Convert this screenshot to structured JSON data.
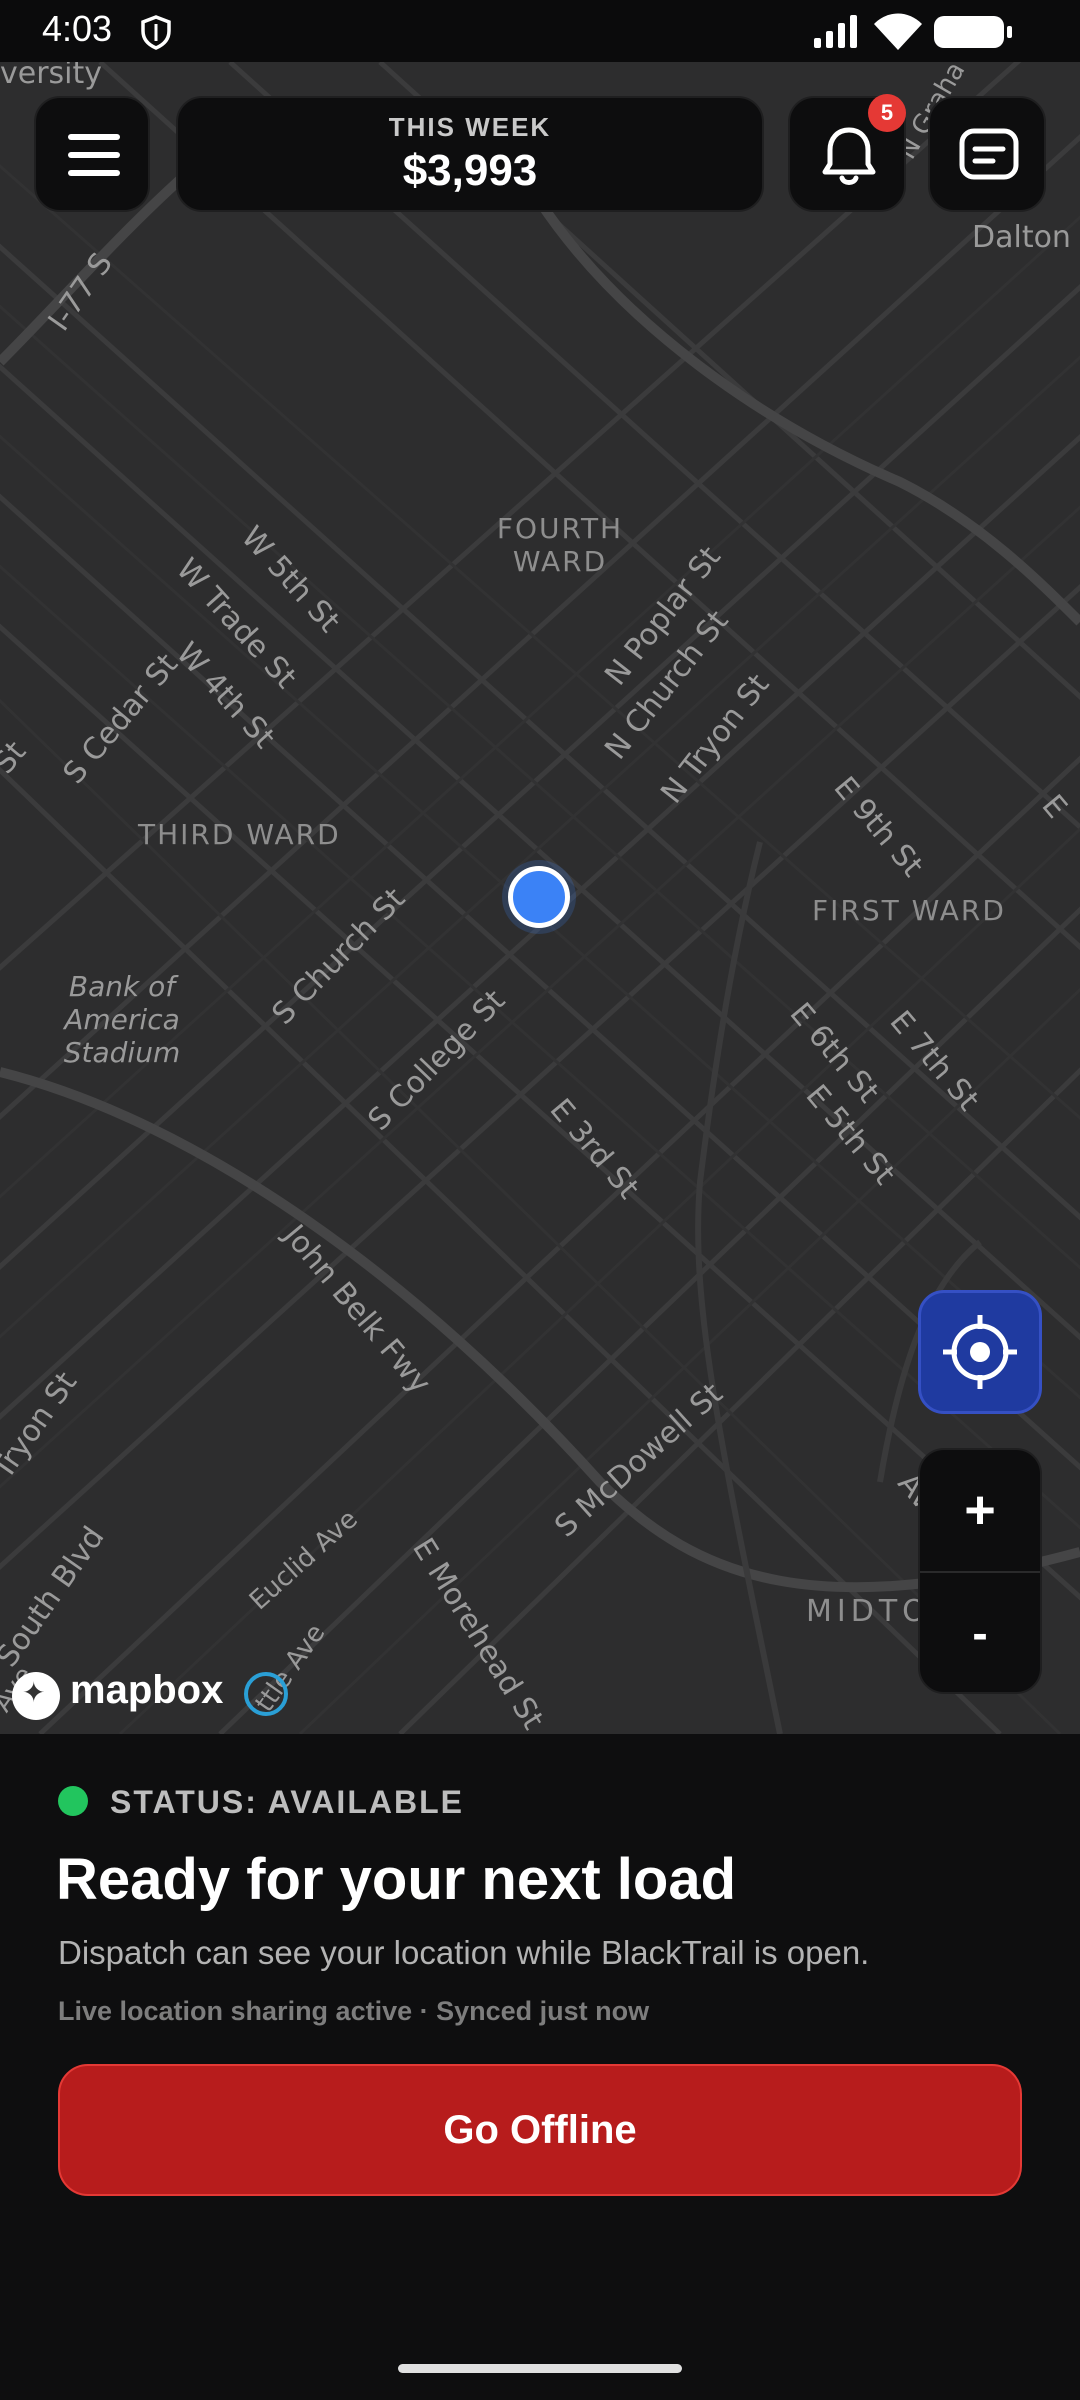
{
  "status_bar": {
    "time": "4:03"
  },
  "header": {
    "week_label": "THIS WEEK",
    "week_amount": "$3,993",
    "notification_count": "5"
  },
  "map": {
    "streets": [
      "W 5th St",
      "W Trade St",
      "W 4th St",
      "S Cedar St",
      "N Poplar St",
      "N Church St",
      "N Tryon St",
      "E 9th St",
      "S Church St",
      "S College St",
      "E 3rd St",
      "E 6th St",
      "E 7th St",
      "E 5th St",
      "John Belk Fwy",
      "S McDowell St",
      "E Morehead St",
      "Euclid Ave",
      "South Blvd",
      "I-77 S",
      "Tryon St",
      "Dalton A",
      "ttle Ave",
      "Ave",
      "St",
      "E",
      "versity",
      "N Graha"
    ],
    "districts": [
      "FOURTH WARD",
      "THIRD WARD",
      "FIRST WARD",
      "MIDTOWN"
    ],
    "stadium": "Bank of America Stadium",
    "attribution": "mapbox",
    "zoom_in_label": "+",
    "zoom_out_label": "-"
  },
  "panel": {
    "status": "STATUS: AVAILABLE",
    "headline": "Ready for your next load",
    "subtext": "Dispatch can see your location while BlackTrail is open.",
    "meta": "Live location sharing active · Synced just now",
    "button_label": "Go Offline"
  },
  "colors": {
    "accent_red": "#b71c1c",
    "status_green": "#22c55e",
    "locate_blue": "#1f3aa0",
    "pin_blue": "#3b82f6",
    "badge_red": "#e53935"
  }
}
